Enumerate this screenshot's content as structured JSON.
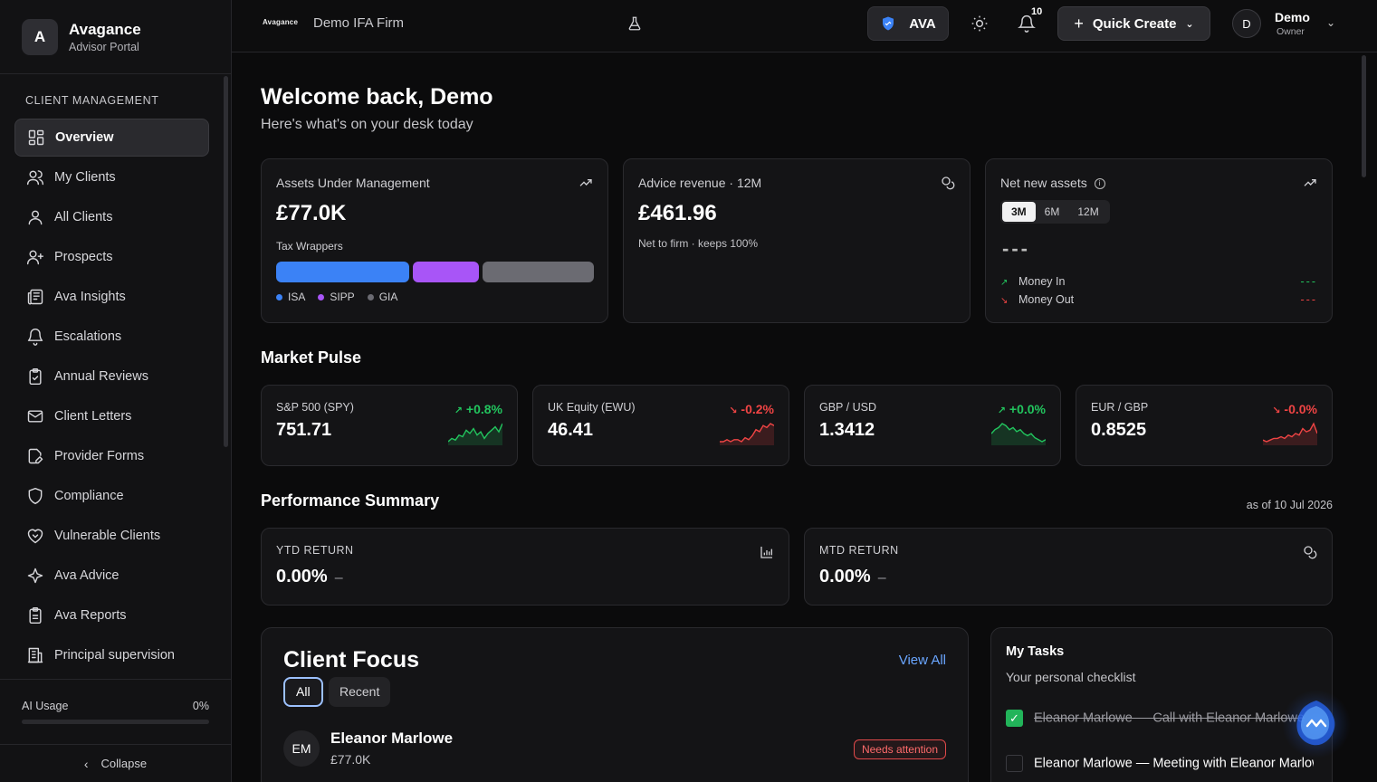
{
  "brand": {
    "logo_letter": "A",
    "name": "Avagance",
    "subtitle": "Advisor Portal"
  },
  "sidebar": {
    "section": "CLIENT MANAGEMENT",
    "items": [
      {
        "label": "Overview",
        "icon": "grid-icon",
        "active": true
      },
      {
        "label": "My Clients",
        "icon": "users-icon"
      },
      {
        "label": "All Clients",
        "icon": "user-icon"
      },
      {
        "label": "Prospects",
        "icon": "user-plus-icon"
      },
      {
        "label": "Ava Insights",
        "icon": "newspaper-icon"
      },
      {
        "label": "Escalations",
        "icon": "bell-icon"
      },
      {
        "label": "Annual Reviews",
        "icon": "clipboard-check-icon"
      },
      {
        "label": "Client Letters",
        "icon": "mail-icon"
      },
      {
        "label": "Provider Forms",
        "icon": "file-edit-icon"
      },
      {
        "label": "Compliance",
        "icon": "shield-icon"
      },
      {
        "label": "Vulnerable Clients",
        "icon": "heart-handshake-icon"
      },
      {
        "label": "Ava Advice",
        "icon": "sparkle-icon"
      },
      {
        "label": "Ava Reports",
        "icon": "clipboard-icon"
      },
      {
        "label": "Principal supervision",
        "icon": "building-icon"
      }
    ],
    "ai_usage": {
      "label": "AI Usage",
      "value": "0%",
      "fraction": 0
    },
    "collapse_label": "Collapse"
  },
  "header": {
    "firm_logo_text": "Avagance",
    "firm_name": "Demo IFA Firm",
    "ava_label": "AVA",
    "notifications_count": "10",
    "quick_create_label": "Quick Create",
    "user": {
      "initial": "D",
      "name": "Demo",
      "role": "Owner"
    }
  },
  "welcome": {
    "title": "Welcome back, Demo",
    "subtitle": "Here's what's on your desk today"
  },
  "aum": {
    "title": "Assets Under Management",
    "value": "£77.0K",
    "wrappers_label": "Tax Wrappers",
    "wrappers": [
      {
        "name": "ISA",
        "color": "#3b82f6",
        "share": 0.43
      },
      {
        "name": "SIPP",
        "color": "#a855f7",
        "share": 0.21
      },
      {
        "name": "GIA",
        "color": "#6b6b72",
        "share": 0.36
      }
    ]
  },
  "revenue": {
    "title": "Advice revenue · 12M",
    "value": "£461.96",
    "note": "Net to firm · keeps 100%"
  },
  "net_new": {
    "title": "Net new assets",
    "periods": [
      "3M",
      "6M",
      "12M"
    ],
    "selected_period": "3M",
    "value": "---",
    "money_in_label": "Money In",
    "money_in_value": "---",
    "money_out_label": "Money Out",
    "money_out_value": "---"
  },
  "market_pulse": {
    "title": "Market Pulse",
    "tickers": [
      {
        "name": "S&P 500 (SPY)",
        "value": "751.71",
        "change": "+0.8%",
        "direction": "up",
        "color": "#22c55e",
        "spark": [
          5,
          7,
          6,
          9,
          8,
          12,
          10,
          13,
          9,
          11,
          7,
          10,
          12,
          14,
          11,
          16
        ]
      },
      {
        "name": "UK Equity (EWU)",
        "value": "46.41",
        "change": "-0.2%",
        "direction": "down",
        "color": "#ef4444",
        "spark": [
          4,
          4,
          5,
          4,
          5,
          5,
          4,
          6,
          5,
          7,
          10,
          9,
          12,
          11,
          13,
          12
        ]
      },
      {
        "name": "GBP / USD",
        "value": "1.3412",
        "change": "+0.0%",
        "direction": "up",
        "color": "#22c55e",
        "spark": [
          10,
          12,
          13,
          15,
          14,
          12,
          13,
          11,
          12,
          10,
          9,
          10,
          8,
          7,
          6,
          7
        ]
      },
      {
        "name": "EUR / GBP",
        "value": "0.8525",
        "change": "-0.0%",
        "direction": "down",
        "color": "#ef4444",
        "spark": [
          5,
          4,
          5,
          6,
          6,
          7,
          6,
          8,
          7,
          9,
          8,
          12,
          10,
          11,
          15,
          9
        ]
      }
    ]
  },
  "performance": {
    "title": "Performance Summary",
    "as_of": "as of 10 Jul 2026",
    "ytd_label": "YTD RETURN",
    "ytd_value": "0.00%",
    "mtd_label": "MTD RETURN",
    "mtd_value": "0.00%",
    "dash": "–"
  },
  "client_focus": {
    "title": "Client Focus",
    "view_all": "View All",
    "filters": [
      "All",
      "Recent"
    ],
    "client": {
      "initials": "EM",
      "name": "Eleanor Marlowe",
      "aum": "£77.0K",
      "badge": "Needs attention"
    }
  },
  "tasks": {
    "title": "My Tasks",
    "subtitle": "Your personal checklist",
    "items": [
      {
        "label": "Eleanor Marlowe — Call with Eleanor Marlowe",
        "done": true
      },
      {
        "label": "Eleanor Marlowe — Meeting with Eleanor Marlowe",
        "done": false
      }
    ]
  }
}
